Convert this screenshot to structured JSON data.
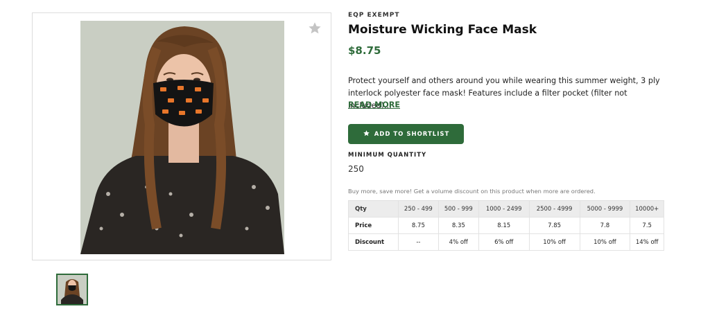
{
  "product": {
    "brand": "EQP EXEMPT",
    "title": "Moisture Wicking Face Mask",
    "price": "$8.75",
    "description": "Protect yourself and others around you while wearing this summer weight, 3 ply interlock polyester face mask! Features include a filter pocket (filter not included)...",
    "read_more": "READ MORE",
    "shortlist_label": "ADD TO SHORTLIST",
    "min_qty_label": "MINIMUM QUANTITY",
    "min_qty_value": "250",
    "discount_note": "Buy more, save more! Get a volume discount on this product when more are ordered."
  },
  "pricing_table": {
    "headers": [
      "Qty",
      "250 - 499",
      "500 - 999",
      "1000 - 2499",
      "2500 - 4999",
      "5000 - 9999",
      "10000+"
    ],
    "rows": [
      [
        "Price",
        "8.75",
        "8.35",
        "8.15",
        "7.85",
        "7.8",
        "7.5"
      ],
      [
        "Discount",
        "--",
        "4% off",
        "6% off",
        "10% off",
        "10% off",
        "14% off"
      ]
    ]
  },
  "icons": {
    "favorite": "star-icon",
    "shortlist": "star-icon"
  },
  "colors": {
    "accent": "#2e6b3a",
    "table_header_bg": "#ececec"
  }
}
